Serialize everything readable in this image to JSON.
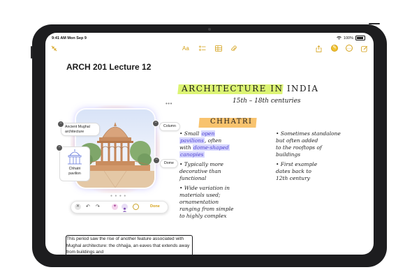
{
  "status": {
    "time": "9:41 AM  Mon Sep 9",
    "battery": "100%"
  },
  "toolbar": {
    "left_icon": "collapse-icon",
    "icons": [
      "text-format-icon",
      "checklist-icon",
      "table-icon",
      "attachment-icon",
      "share-icon",
      "pencil-tip-icon",
      "more-icon",
      "compose-icon"
    ]
  },
  "note": {
    "title": "ARCH 201 Lecture 12",
    "body_text": "This period saw the rise of another feature associated with Mughal architecture: the chhajja, an eaves that extends away from buildings and"
  },
  "image_card": {
    "callouts": {
      "ancient": "Ancient Mughal architecture",
      "column": "Column",
      "dome": "Dome",
      "chhatri": "Chhatri pavilion"
    },
    "more": "•••"
  },
  "bottom_tools": {
    "done": "Done"
  },
  "handwriting": {
    "title": "ARCHITECTURE IN INDIA",
    "centuries": "15th – 18th centuries",
    "chhatri": "CHHATRI",
    "left_bullets": [
      [
        "• Small ",
        "open",
        ""
      ],
      [
        "  ",
        "pavilions",
        ", often"
      ],
      [
        "  with ",
        "dome-shaped",
        ""
      ],
      [
        "  ",
        "canopies",
        ""
      ]
    ],
    "left_bullets_2": [
      "• Typically more",
      "  decorative than",
      "  functional"
    ],
    "left_bullets_3": [
      "• Wide variation in",
      "  materials used;",
      "  ornamentation",
      "  ranging from simple",
      "  to highly complex"
    ],
    "right_bullets": [
      "• Sometimes standalone",
      "  but often added",
      "  to the rooftops of",
      "  buildings"
    ],
    "right_bullets_2": [
      "• First example",
      "  dates back to",
      "  12th century"
    ]
  },
  "colors": {
    "accent": "#d4a017",
    "highlight_green": "#d6f25a",
    "highlight_orange": "#f7b955",
    "ink_blue": "#4b3fcf"
  }
}
